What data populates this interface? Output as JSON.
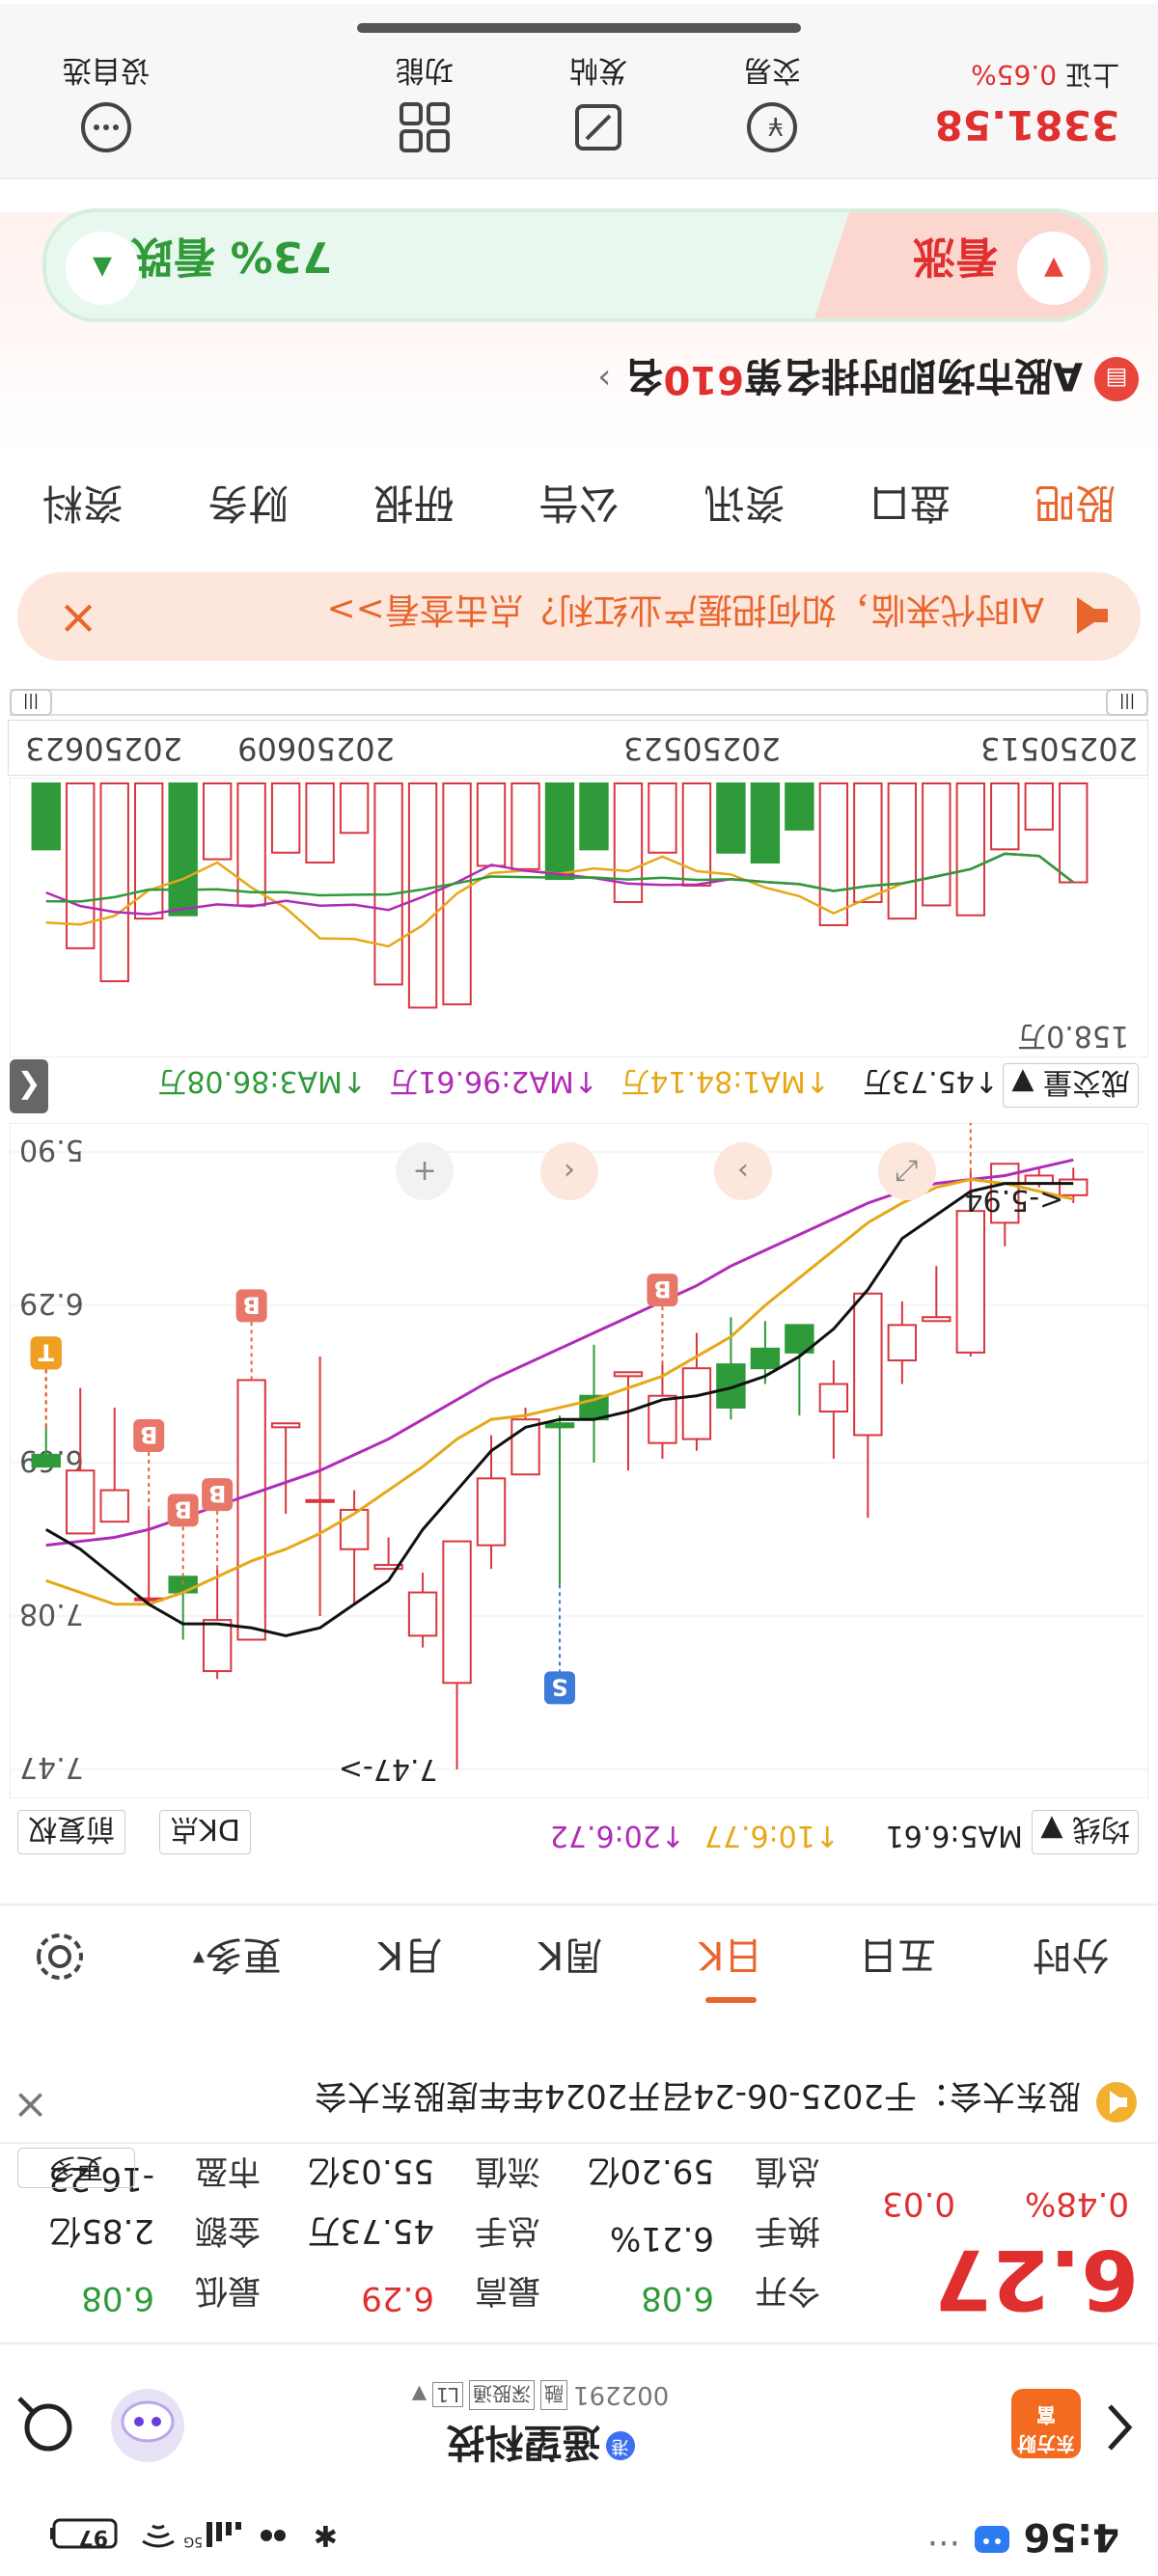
{
  "status_bar": {
    "time": "4:56",
    "battery": "97",
    "dots": "···"
  },
  "header": {
    "stock_name": "遥望科技",
    "stock_code": "002291",
    "badges": [
      "融",
      "深股通",
      "L1"
    ],
    "brand": "东方财富"
  },
  "quote": {
    "price": "6.27",
    "change": "0.03",
    "change_pct": "0.48%",
    "stats": [
      [
        {
          "label": "今开",
          "value": "6.08",
          "color": "#2f9a3a"
        },
        {
          "label": "最高",
          "value": "6.29",
          "color": "#e02f2f"
        },
        {
          "label": "最低",
          "value": "6.08",
          "color": "#2f9a3a"
        }
      ],
      [
        {
          "label": "换手",
          "value": "6.21%",
          "color": "#222"
        },
        {
          "label": "总手",
          "value": "45.73万",
          "color": "#222"
        },
        {
          "label": "金额",
          "value": "2.85亿",
          "color": "#222"
        }
      ],
      [
        {
          "label": "总值",
          "value": "59.20亿",
          "color": "#222"
        },
        {
          "label": "流值",
          "value": "55.03亿",
          "color": "#222"
        },
        {
          "label": "市盈",
          "value": "-16.23",
          "color": "#222"
        }
      ]
    ],
    "more_label": "更多"
  },
  "notice": {
    "text": "股东大会：于2025-06-24召开2024年年度股东大会"
  },
  "period_tabs": {
    "items": [
      "分时",
      "五日",
      "日K",
      "周K",
      "月K",
      "更多"
    ],
    "active": 2
  },
  "ma_line": {
    "label": "均线",
    "ma5": "MA5:6.61",
    "ma10": "10:6.77",
    "ma20": "20:6.72",
    "dk_label": "DK点",
    "fq_label": "前复权"
  },
  "chart_data": {
    "type": "candlestick",
    "x": [
      "20250513",
      "20250514",
      "20250515",
      "20250516",
      "20250519",
      "20250520",
      "20250521",
      "20250522",
      "20250523",
      "20250526",
      "20250527",
      "20250528",
      "20250529",
      "20250530",
      "20250603",
      "20250604",
      "20250605",
      "20250606",
      "20250609",
      "20250610",
      "20250611",
      "20250612",
      "20250613",
      "20250616",
      "20250617",
      "20250618",
      "20250619",
      "20250620",
      "20250623",
      "20250624",
      "20250625"
    ],
    "candles": [
      {
        "o": 5.97,
        "h": 6.03,
        "l": 5.94,
        "c": 6.01
      },
      {
        "o": 5.96,
        "h": 5.99,
        "l": 5.94,
        "c": 5.98
      },
      {
        "o": 5.93,
        "h": 6.14,
        "l": 5.93,
        "c": 6.08
      },
      {
        "o": 6.05,
        "h": 6.42,
        "l": 5.95,
        "c": 6.41
      },
      {
        "o": 6.32,
        "h": 6.33,
        "l": 6.19,
        "c": 6.33
      },
      {
        "o": 6.34,
        "h": 6.49,
        "l": 6.28,
        "c": 6.43
      },
      {
        "o": 6.26,
        "h": 6.83,
        "l": 6.26,
        "c": 6.62
      },
      {
        "o": 6.49,
        "h": 6.68,
        "l": 6.43,
        "c": 6.56
      },
      {
        "o": 6.41,
        "h": 6.57,
        "l": 6.38,
        "c": 6.34
      },
      {
        "o": 6.45,
        "h": 6.49,
        "l": 6.33,
        "c": 6.4
      },
      {
        "o": 6.55,
        "h": 6.58,
        "l": 6.32,
        "c": 6.44
      },
      {
        "o": 6.45,
        "h": 6.66,
        "l": 6.36,
        "c": 6.63
      },
      {
        "o": 6.52,
        "h": 6.68,
        "l": 6.44,
        "c": 6.64
      },
      {
        "o": 6.46,
        "h": 6.71,
        "l": 6.46,
        "c": 6.47
      },
      {
        "o": 6.58,
        "h": 6.69,
        "l": 6.39,
        "c": 6.52
      },
      {
        "o": 6.6,
        "h": 7.0,
        "l": 6.57,
        "c": 6.59
      },
      {
        "o": 6.58,
        "h": 6.63,
        "l": 6.55,
        "c": 6.72
      },
      {
        "o": 6.73,
        "h": 6.96,
        "l": 6.62,
        "c": 6.9
      },
      {
        "o": 6.89,
        "h": 7.47,
        "l": 6.89,
        "c": 7.25
      },
      {
        "o": 7.02,
        "h": 7.16,
        "l": 6.97,
        "c": 7.13
      },
      {
        "o": 6.95,
        "h": 6.96,
        "l": 6.88,
        "c": 6.96
      },
      {
        "o": 6.81,
        "h": 7.05,
        "l": 6.76,
        "c": 6.91
      },
      {
        "o": 6.79,
        "h": 7.08,
        "l": 6.42,
        "c": 6.79
      },
      {
        "o": 6.59,
        "h": 6.82,
        "l": 6.59,
        "c": 6.6
      },
      {
        "o": 6.48,
        "h": 6.69,
        "l": 6.48,
        "c": 7.14
      },
      {
        "o": 7.09,
        "h": 7.24,
        "l": 6.96,
        "c": 7.22
      },
      {
        "o": 7.02,
        "h": 7.14,
        "l": 7.0,
        "c": 6.98
      },
      {
        "o": 7.04,
        "h": 7.05,
        "l": 6.81,
        "c": 7.04
      },
      {
        "o": 6.76,
        "h": 6.66,
        "l": 6.55,
        "c": 6.84
      },
      {
        "o": 6.71,
        "h": 6.69,
        "l": 6.5,
        "c": 6.87
      },
      {
        "o": 6.7,
        "h": 6.56,
        "l": 6.6,
        "c": 6.67
      }
    ],
    "volume": [
      30,
      14,
      20,
      40,
      37,
      41,
      36,
      43,
      14,
      24,
      21,
      31,
      21,
      36,
      20,
      29,
      26,
      25,
      67,
      68,
      61,
      15,
      24,
      21,
      37,
      23,
      40,
      41,
      60,
      50,
      20
    ],
    "ma5": [
      5.98,
      5.98,
      5.98,
      6.0,
      6.06,
      6.12,
      6.25,
      6.35,
      6.42,
      6.47,
      6.5,
      6.52,
      6.53,
      6.56,
      6.58,
      6.58,
      6.6,
      6.66,
      6.76,
      6.86,
      6.99,
      7.05,
      7.11,
      7.13,
      7.11,
      7.1,
      7.1,
      7.05,
      6.98,
      6.91,
      6.86
    ],
    "ma10": [
      6.02,
      6.0,
      5.98,
      5.97,
      5.99,
      6.03,
      6.08,
      6.15,
      6.22,
      6.29,
      6.37,
      6.42,
      6.47,
      6.5,
      6.53,
      6.55,
      6.57,
      6.58,
      6.63,
      6.7,
      6.76,
      6.82,
      6.87,
      6.91,
      6.94,
      6.98,
      7.02,
      7.05,
      7.05,
      7.02,
      6.99
    ],
    "ma20": [
      5.92,
      5.94,
      5.96,
      5.97,
      5.98,
      6.0,
      6.03,
      6.07,
      6.11,
      6.15,
      6.19,
      6.24,
      6.28,
      6.32,
      6.36,
      6.4,
      6.44,
      6.48,
      6.53,
      6.58,
      6.63,
      6.67,
      6.71,
      6.74,
      6.77,
      6.8,
      6.83,
      6.86,
      6.88,
      6.89,
      6.9
    ],
    "ylim": [
      5.9,
      7.47
    ],
    "y_ticks": [
      "5.90",
      "6.29",
      "6.69",
      "7.08",
      "7.47"
    ],
    "x_ticks": [
      "20250513",
      "20250523",
      "20250609",
      "20250623"
    ],
    "high_label": "7.47->",
    "low_label": "<-5.94",
    "volume_max_label": "158.0万",
    "markers": [
      {
        "i": 3,
        "t": "B"
      },
      {
        "i": 12,
        "t": "B"
      },
      {
        "i": 15,
        "t": "S"
      },
      {
        "i": 24,
        "t": "B"
      },
      {
        "i": 25,
        "t": "B"
      },
      {
        "i": 26,
        "t": "B"
      },
      {
        "i": 27,
        "t": "B"
      },
      {
        "i": 30,
        "t": "B"
      },
      {
        "i": 32,
        "t": "B"
      },
      {
        "i": 33,
        "t": "T"
      }
    ]
  },
  "volume_bar": {
    "label": "成交量",
    "total": "45.73万",
    "ma1": "MA1:84.14万",
    "ma2": "MA2:96.61万",
    "ma3": "MA3:86.08万"
  },
  "promo": {
    "text": "AI时代来临，如何把握产业红利？点击查看>>"
  },
  "content_tabs": {
    "items": [
      "股吧",
      "盘口",
      "资讯",
      "公告",
      "研报",
      "财务",
      "资料"
    ],
    "active": 0
  },
  "ranking": {
    "text": "A股市场即时排名第",
    "rank": "610",
    "suffix": "名"
  },
  "sentiment": {
    "bull_label": "看涨",
    "bear_label": "73% 看跌"
  },
  "bottom_bar": {
    "index_name": "上证",
    "index_value": "3381.58",
    "index_pct": "0.65%",
    "actions": [
      "交易",
      "发帖",
      "功能",
      "设自选"
    ]
  }
}
